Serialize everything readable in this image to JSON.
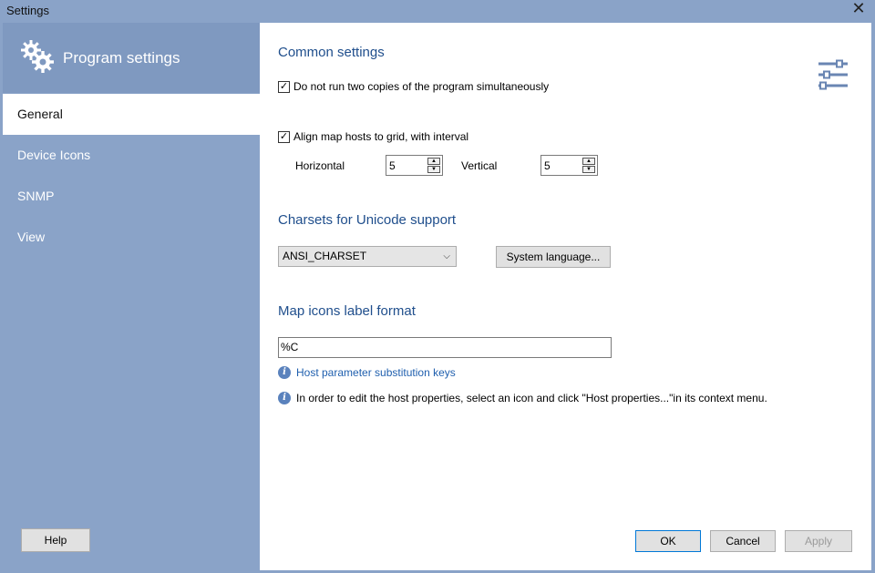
{
  "window": {
    "title": "Settings",
    "close_glyph": "✕"
  },
  "sidebar": {
    "header_icon": "gear-icon",
    "title": "Program settings",
    "items": [
      {
        "label": "General",
        "active": true
      },
      {
        "label": "Device Icons",
        "active": false
      },
      {
        "label": "SNMP",
        "active": false
      },
      {
        "label": "View",
        "active": false
      }
    ],
    "help_label": "Help"
  },
  "common": {
    "title": "Common settings",
    "single_instance": {
      "label": "Do not run two copies of the program simultaneously",
      "checked": true
    },
    "align_grid": {
      "label": "Align map hosts to grid, with interval",
      "checked": true
    },
    "horizontal": {
      "label": "Horizontal",
      "value": "5"
    },
    "vertical": {
      "label": "Vertical",
      "value": "5"
    }
  },
  "charsets": {
    "title": "Charsets for Unicode support",
    "selected": "ANSI_CHARSET",
    "system_language_label": "System language..."
  },
  "map_labels": {
    "title": "Map icons label format",
    "value": "%C",
    "link": "Host parameter substitution keys",
    "hint": "In order to edit the host properties, select an icon and click \"Host properties...\"in its context menu."
  },
  "footer": {
    "ok_label": "OK",
    "cancel_label": "Cancel",
    "apply_label": "Apply"
  },
  "colors": {
    "accent": "#1f4e8c",
    "sidebar": "#8aa3c8",
    "header": "#7f99c0"
  }
}
